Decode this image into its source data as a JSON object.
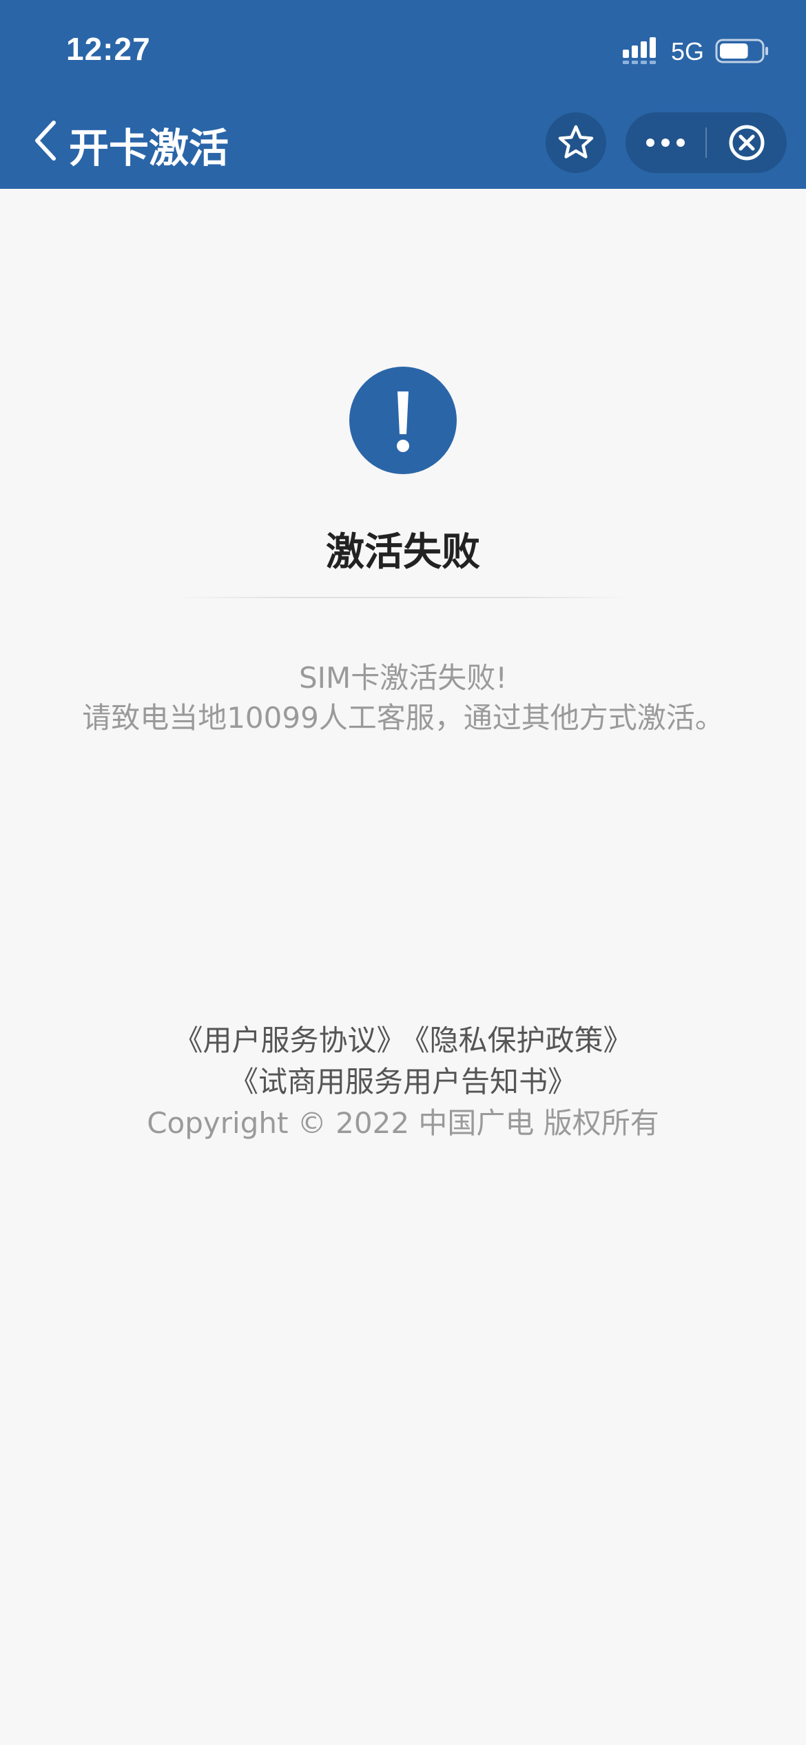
{
  "status_bar": {
    "time": "12:27",
    "network": "5G",
    "battery_level": 0.7
  },
  "nav": {
    "title": "开卡激活"
  },
  "result": {
    "icon": "exclamation-icon",
    "title": "激活失败",
    "message_line_1": "SIM卡激活失败!",
    "message_line_2": "请致电当地10099人工客服，通过其他方式激活。"
  },
  "footer": {
    "links": [
      "《用户服务协议》",
      "《隐私保护政策》",
      "《试商用服务用户告知书》"
    ],
    "copyright": "Copyright © 2022 中国广电 版权所有"
  },
  "colors": {
    "header_bg": "#2a65a8",
    "accent": "#2a65a8",
    "page_bg": "#f7f7f7"
  }
}
